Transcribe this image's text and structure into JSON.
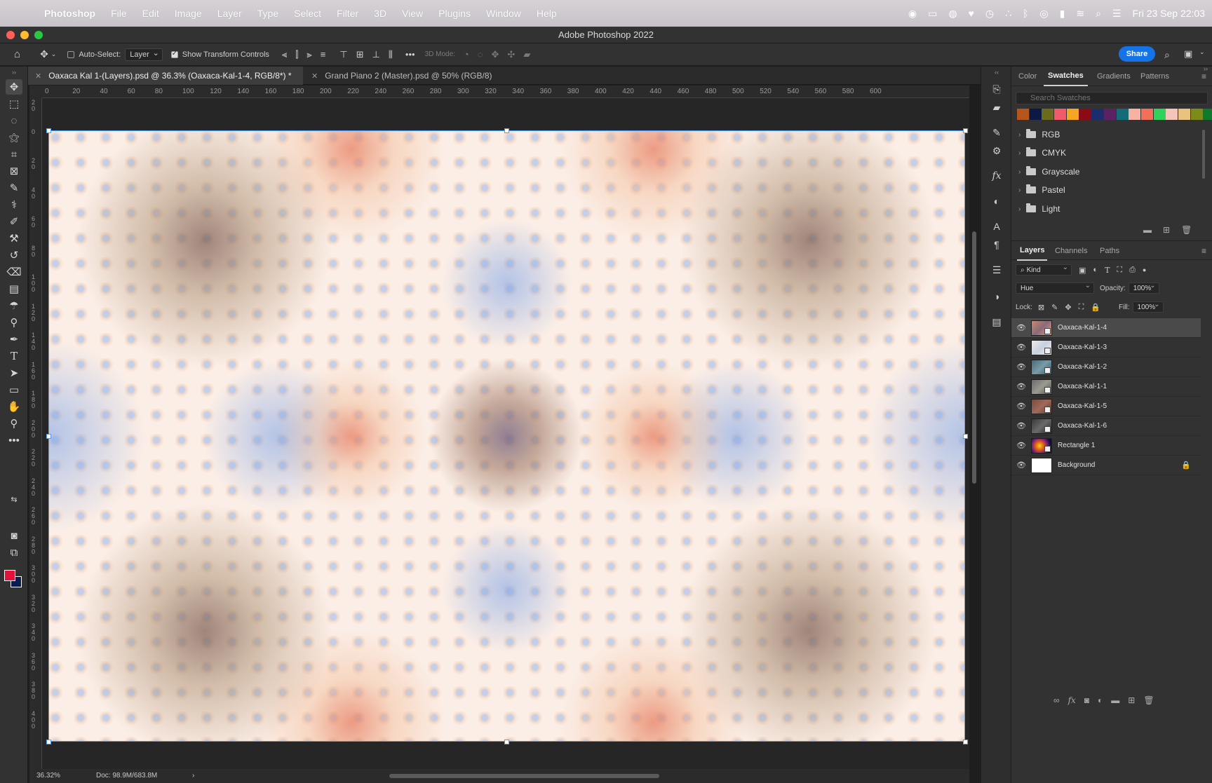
{
  "menubar": {
    "app": "Photoshop",
    "items": [
      "File",
      "Edit",
      "Image",
      "Layer",
      "Type",
      "Select",
      "Filter",
      "3D",
      "View",
      "Plugins",
      "Window",
      "Help"
    ],
    "clock": "Fri 23 Sep  22:03"
  },
  "window": {
    "title": "Adobe Photoshop 2022"
  },
  "options": {
    "auto_select_label": "Auto-Select:",
    "auto_select_value": "Layer",
    "show_transform_label": "Show Transform Controls",
    "mode_3d_label": "3D Mode:",
    "share_label": "Share"
  },
  "tabs": [
    {
      "label": "Oaxaca Kal 1-(Layers).psd @ 36.3% (Oaxaca-Kal-1-4, RGB/8*) *"
    },
    {
      "label": "Grand Piano 2 (Master).psd @ 50% (RGB/8)"
    }
  ],
  "ruler_top": [
    "0",
    "20",
    "40",
    "60",
    "80",
    "100",
    "120",
    "140",
    "160",
    "180",
    "200",
    "220",
    "240",
    "260",
    "280",
    "300",
    "320",
    "340",
    "360",
    "380",
    "400",
    "420",
    "440",
    "460",
    "480",
    "500",
    "520",
    "540",
    "560",
    "580",
    "600"
  ],
  "ruler_left": [
    "20",
    "0",
    "20",
    "40",
    "60",
    "80",
    "100",
    "120",
    "140",
    "160",
    "180",
    "200",
    "220",
    "240",
    "260",
    "280",
    "300",
    "320",
    "340",
    "360",
    "380",
    "400"
  ],
  "status": {
    "zoom": "36.32%",
    "doc": "Doc: 98.9M/683.8M",
    "arrow": "›"
  },
  "swatches_panel": {
    "tabs": [
      "Color",
      "Swatches",
      "Gradients",
      "Patterns"
    ],
    "search_placeholder": "Search Swatches",
    "colors": [
      "#b5561c",
      "#0b1a45",
      "#6b6b1b",
      "#f25a6a",
      "#f5a623",
      "#8b0a14",
      "#1b2d6b",
      "#5b2160",
      "#146c77",
      "#f6b3a4",
      "#f36f5a",
      "#2fd35c",
      "#f5c4ba",
      "#e9c280",
      "#7d8b1a",
      "#0f7a2e",
      "#f08a1c"
    ],
    "groups": [
      "RGB",
      "CMYK",
      "Grayscale",
      "Pastel",
      "Light"
    ]
  },
  "layers_panel": {
    "tabs": [
      "Layers",
      "Channels",
      "Paths"
    ],
    "filter_kind": "Kind",
    "blend_mode": "Hue",
    "opacity_label": "Opacity:",
    "opacity_value": "100%",
    "lock_label": "Lock:",
    "fill_label": "Fill:",
    "fill_value": "100%",
    "layers": [
      {
        "name": "Oaxaca-Kal-1-4",
        "selected": true
      },
      {
        "name": "Oaxaca-Kal-1-3"
      },
      {
        "name": "Oaxaca-Kal-1-2"
      },
      {
        "name": "Oaxaca-Kal-1-1"
      },
      {
        "name": "Oaxaca-Kal-1-5"
      },
      {
        "name": "Oaxaca-Kal-1-6"
      },
      {
        "name": "Rectangle 1"
      },
      {
        "name": "Background",
        "locked": true
      }
    ]
  },
  "tool_colors": {
    "foreground": "#e3123b",
    "background": "#0c1a52"
  }
}
